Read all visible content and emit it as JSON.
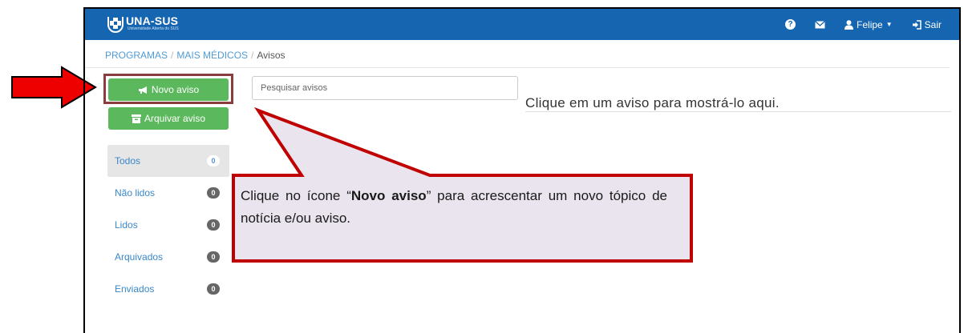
{
  "header": {
    "brand": "UNA-SUS",
    "brand_sub": "Universidade Aberta do SUS",
    "help_icon": "help-circle-icon",
    "mail_icon": "envelope-icon",
    "user_label": "Felipe",
    "logout_label": "Sair",
    "color": "#1565b0"
  },
  "breadcrumb": {
    "items": [
      "PROGRAMAS",
      "MAIS MÉDICOS",
      "Avisos"
    ]
  },
  "actions": {
    "new_label": "Novo aviso",
    "archive_label": "Arquivar aviso",
    "button_color": "#5cb85c"
  },
  "search": {
    "placeholder": "Pesquisar avisos"
  },
  "main": {
    "empty_message": "Clique em um aviso para mostrá-lo aqui."
  },
  "filters": [
    {
      "label": "Todos",
      "count": "0"
    },
    {
      "label": "Não lidos",
      "count": "0"
    },
    {
      "label": "Lidos",
      "count": "0"
    },
    {
      "label": "Arquivados",
      "count": "0"
    },
    {
      "label": "Enviados",
      "count": "0"
    }
  ],
  "callout": {
    "text_before": "Clique no ícone “",
    "text_bold": "Novo aviso",
    "text_after": "” para acrescentar um novo tópico de notícia e/ou aviso.",
    "border_color": "#c00000",
    "fill_color": "#e9e4ee"
  },
  "annotation": {
    "arrow_color": "#ee0000"
  }
}
